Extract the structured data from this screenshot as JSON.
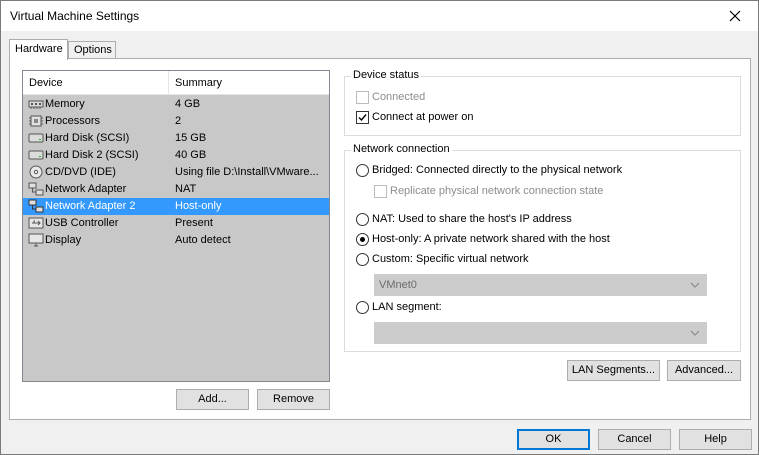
{
  "window": {
    "title": "Virtual Machine Settings"
  },
  "tabs": [
    {
      "label": "Hardware",
      "active": true
    },
    {
      "label": "Options",
      "active": false
    }
  ],
  "device_list": {
    "columns": [
      "Device",
      "Summary"
    ],
    "rows": [
      {
        "device": "Memory",
        "summary": "4 GB",
        "icon": "memory-icon"
      },
      {
        "device": "Processors",
        "summary": "2",
        "icon": "processor-icon"
      },
      {
        "device": "Hard Disk (SCSI)",
        "summary": "15 GB",
        "icon": "hard-disk-icon"
      },
      {
        "device": "Hard Disk 2 (SCSI)",
        "summary": "40 GB",
        "icon": "hard-disk-icon"
      },
      {
        "device": "CD/DVD (IDE)",
        "summary": "Using file D:\\Install\\VMware...",
        "icon": "cd-dvd-icon"
      },
      {
        "device": "Network Adapter",
        "summary": "NAT",
        "icon": "network-adapter-icon"
      },
      {
        "device": "Network Adapter 2",
        "summary": "Host-only",
        "icon": "network-adapter-icon",
        "selected": true
      },
      {
        "device": "USB Controller",
        "summary": "Present",
        "icon": "usb-icon"
      },
      {
        "device": "Display",
        "summary": "Auto detect",
        "icon": "display-icon"
      }
    ]
  },
  "list_buttons": {
    "add": "Add...",
    "remove": "Remove"
  },
  "device_status": {
    "title": "Device status",
    "connected": {
      "label": "Connected",
      "checked": false,
      "enabled": false
    },
    "connect_at_power_on": {
      "label": "Connect at power on",
      "checked": true,
      "enabled": true
    }
  },
  "network_connection": {
    "title": "Network connection",
    "bridged": "Bridged: Connected directly to the physical network",
    "replicate": "Replicate physical network connection state",
    "nat": "NAT: Used to share the host's IP address",
    "host_only": "Host-only: A private network shared with the host",
    "custom": "Custom: Specific virtual network",
    "vmnet_value": "VMnet0",
    "lan_segment": "LAN segment:",
    "lan_segment_value": "",
    "selected": "host_only"
  },
  "network_buttons": {
    "lan_segments": "LAN Segments...",
    "advanced": "Advanced..."
  },
  "dialog_buttons": {
    "ok": "OK",
    "cancel": "Cancel",
    "help": "Help"
  }
}
